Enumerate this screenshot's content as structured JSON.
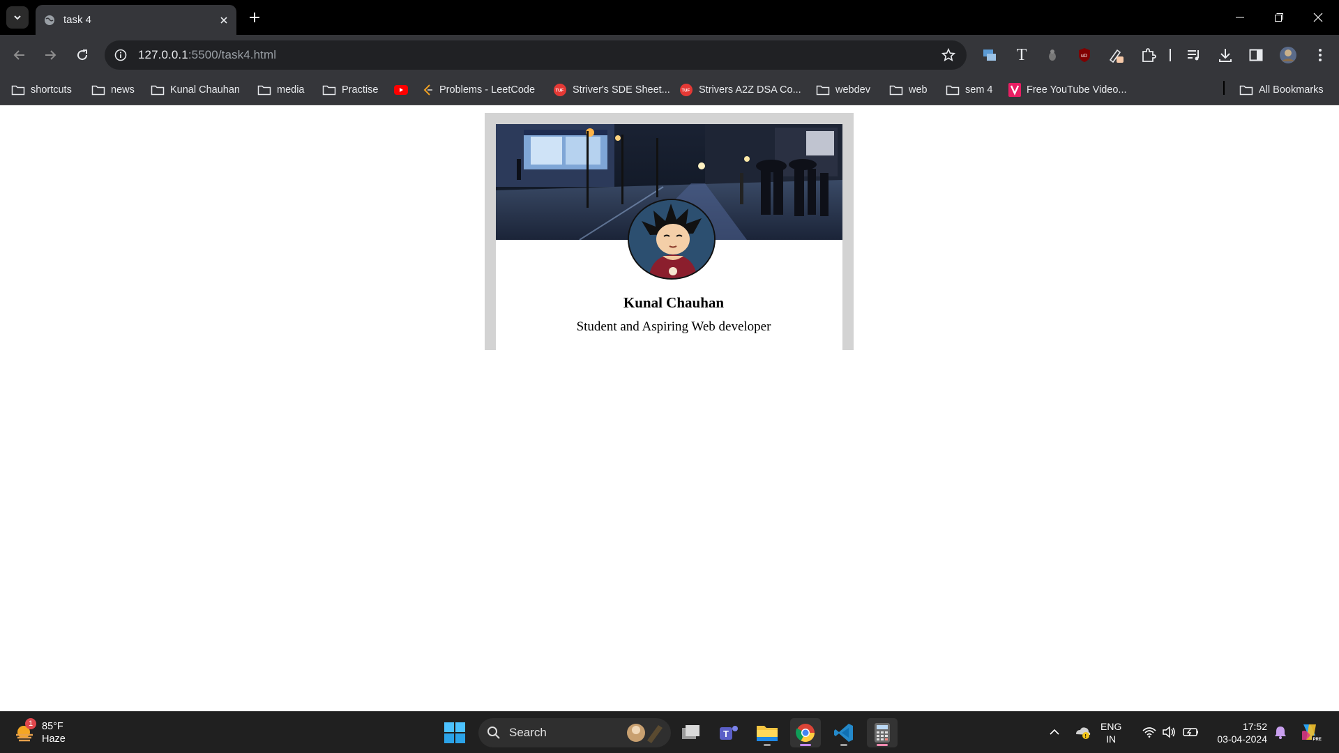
{
  "browser": {
    "tab_title": "task 4",
    "url_host": "127.0.0.1",
    "url_path": ":5500/task4.html"
  },
  "bookmarks": [
    {
      "label": "shortcuts",
      "icon": "folder-icon"
    },
    {
      "label": "news",
      "icon": "folder-icon"
    },
    {
      "label": "Kunal Chauhan",
      "icon": "folder-icon"
    },
    {
      "label": "media",
      "icon": "folder-icon"
    },
    {
      "label": "Practise",
      "icon": "folder-icon"
    },
    {
      "label": "",
      "icon": "youtube-icon"
    },
    {
      "label": "Problems - LeetCode",
      "icon": "leetcode-icon"
    },
    {
      "label": "Striver's SDE Sheet...",
      "icon": "tuf-icon"
    },
    {
      "label": "Strivers A2Z DSA Co...",
      "icon": "tuf-icon"
    },
    {
      "label": "webdev",
      "icon": "folder-icon"
    },
    {
      "label": "web",
      "icon": "folder-icon"
    },
    {
      "label": "sem 4",
      "icon": "folder-icon"
    },
    {
      "label": "Free YouTube Video...",
      "icon": "bookmark-v-icon"
    },
    {
      "label": "All Bookmarks",
      "icon": "folder-icon"
    }
  ],
  "profile": {
    "name": "Kunal Chauhan",
    "role": "Student and Aspiring Web developer"
  },
  "taskbar": {
    "weather_temp": "85°F",
    "weather_desc": "Haze",
    "weather_badge": "1",
    "search_label": "Search",
    "lang_top": "ENG",
    "lang_bottom": "IN",
    "time": "17:52",
    "date": "03-04-2024"
  },
  "colors": {
    "tab_bar": "#000000",
    "toolbar": "#35363a",
    "omnibox": "#202124",
    "card_frame": "#d3d3d3",
    "taskbar": "#202020"
  }
}
